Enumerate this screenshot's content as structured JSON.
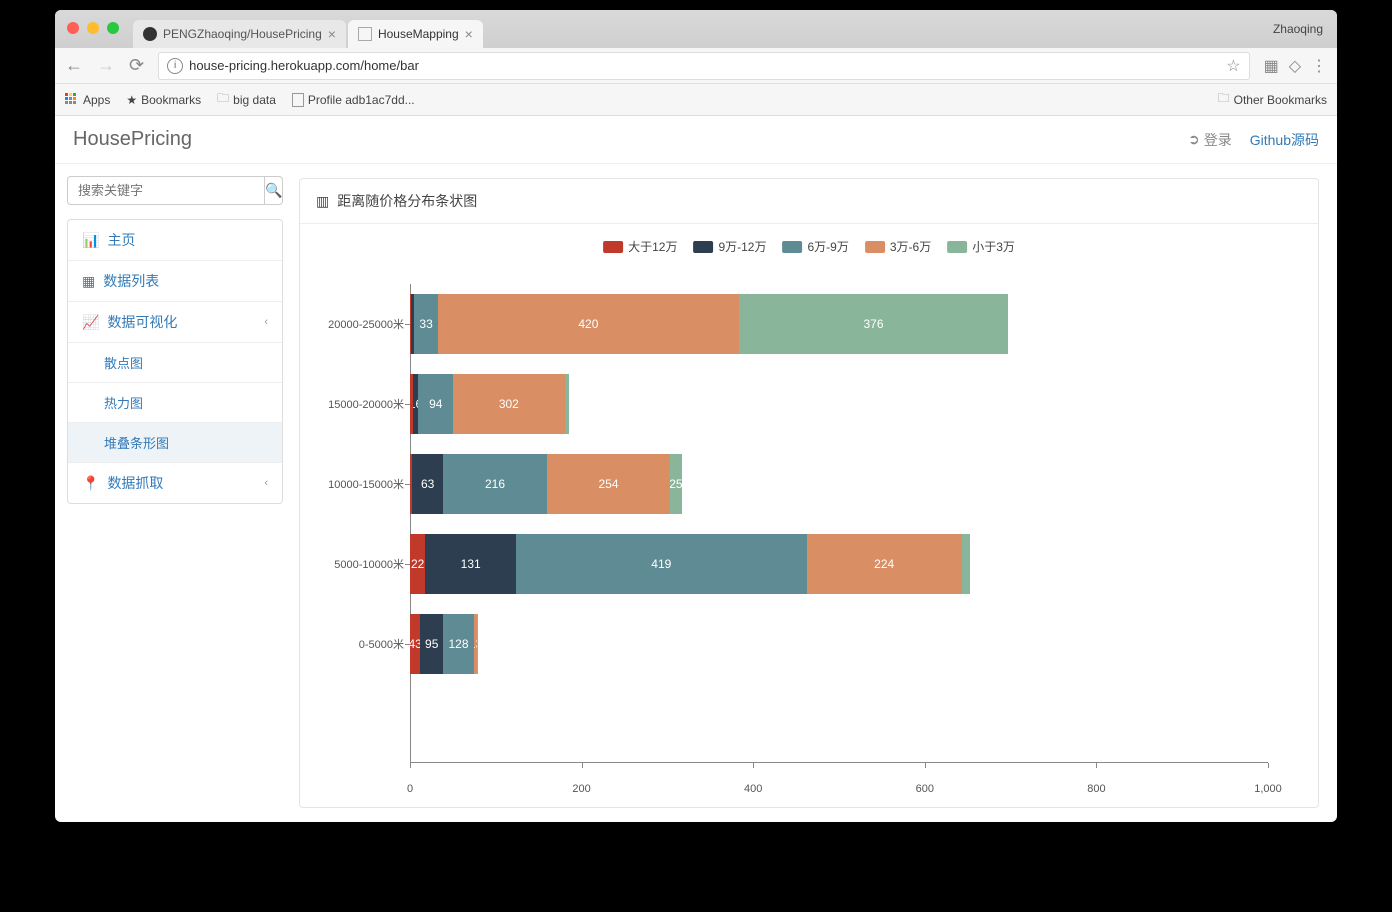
{
  "browser": {
    "profile_name": "Zhaoqing",
    "tabs": [
      {
        "title": "PENGZhaoqing/HousePricing",
        "active": false
      },
      {
        "title": "HouseMapping",
        "active": true
      }
    ],
    "url": "house-pricing.herokuapp.com/home/bar",
    "bookmarks": {
      "apps": "Apps",
      "items": [
        {
          "label": "Bookmarks",
          "icon": "star"
        },
        {
          "label": "big data",
          "icon": "folder"
        },
        {
          "label": "Profile adb1ac7dd...",
          "icon": "page"
        }
      ],
      "right": "Other Bookmarks"
    }
  },
  "app": {
    "brand": "HousePricing",
    "header_links": {
      "login": "登录",
      "github": "Github源码"
    },
    "search_placeholder": "搜索关键字",
    "sidebar": {
      "items": [
        {
          "label": "主页",
          "iconhint": "dashboard"
        },
        {
          "label": "数据列表",
          "iconhint": "table"
        },
        {
          "label": "数据可视化",
          "iconhint": "chart",
          "expandable": true,
          "children": [
            {
              "label": "散点图"
            },
            {
              "label": "热力图"
            },
            {
              "label": "堆叠条形图",
              "active": true
            }
          ]
        },
        {
          "label": "数据抓取",
          "iconhint": "marker",
          "expandable": true
        }
      ]
    }
  },
  "panel": {
    "title": "距离随价格分布条状图"
  },
  "chart_data": {
    "type": "bar",
    "stacked": true,
    "orientation": "horizontal",
    "xlabel": "",
    "ylabel": "",
    "xlim": [
      0,
      1000
    ],
    "xticks": [
      0,
      200,
      400,
      600,
      800,
      1000
    ],
    "categories": [
      "20000-25000米",
      "15000-20000米",
      "10000-15000米",
      "5000-10000米",
      "0-5000米"
    ],
    "series_colors": {
      "大于12万": "#c0392b",
      "9万-12万": "#2c3e50",
      "6万-9万": "#5f8b95",
      "3万-6万": "#d98e63",
      "小于3万": "#89b59b"
    },
    "legend_order": [
      "大于12万",
      "9万-12万",
      "6万-9万",
      "3万-6万",
      "小于3万"
    ],
    "series": [
      {
        "name": "大于12万",
        "values": [
          2,
          7,
          5,
          22,
          43
        ]
      },
      {
        "name": "9万-12万",
        "values": [
          4,
          16,
          63,
          131,
          95
        ]
      },
      {
        "name": "6万-9万",
        "values": [
          33,
          94,
          216,
          419,
          128
        ]
      },
      {
        "name": "3万-6万",
        "values": [
          420,
          302,
          254,
          224,
          13
        ]
      },
      {
        "name": "小于3万",
        "values": [
          376,
          11,
          25,
          12,
          1
        ]
      }
    ]
  }
}
